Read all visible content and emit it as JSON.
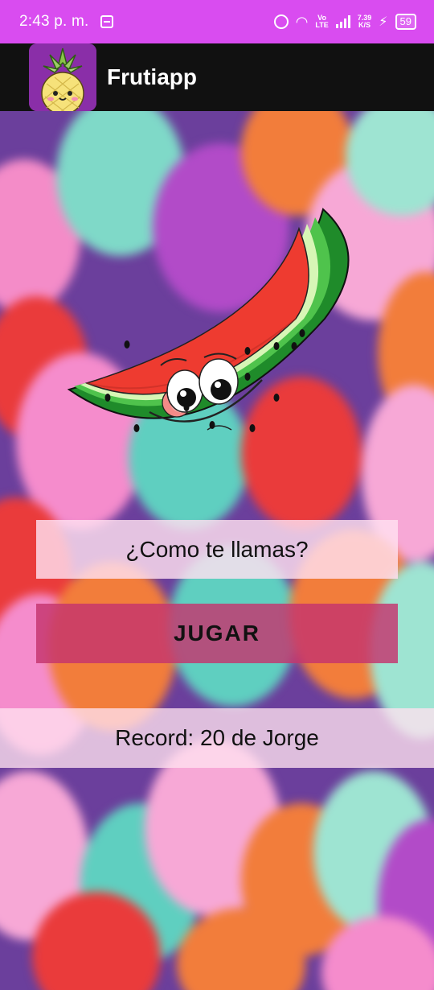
{
  "status_bar": {
    "time": "2:43 p. m.",
    "network_label_top": "Vo",
    "network_label_bottom": "LTE",
    "speed_top": "7.39",
    "speed_bottom": "K/S",
    "battery": "59"
  },
  "app_bar": {
    "title": "Frutiapp",
    "logo_icon": "pineapple-icon"
  },
  "main": {
    "fruit_icon": "watermelon-icon",
    "name_input": {
      "placeholder": "¿Como te llamas?",
      "value": ""
    },
    "play_button_label": "JUGAR",
    "record_text": "Record: 20 de Jorge"
  },
  "colors": {
    "status_bar": "#d94cf0",
    "app_bar": "#111111",
    "play_button": "#c4346e"
  }
}
